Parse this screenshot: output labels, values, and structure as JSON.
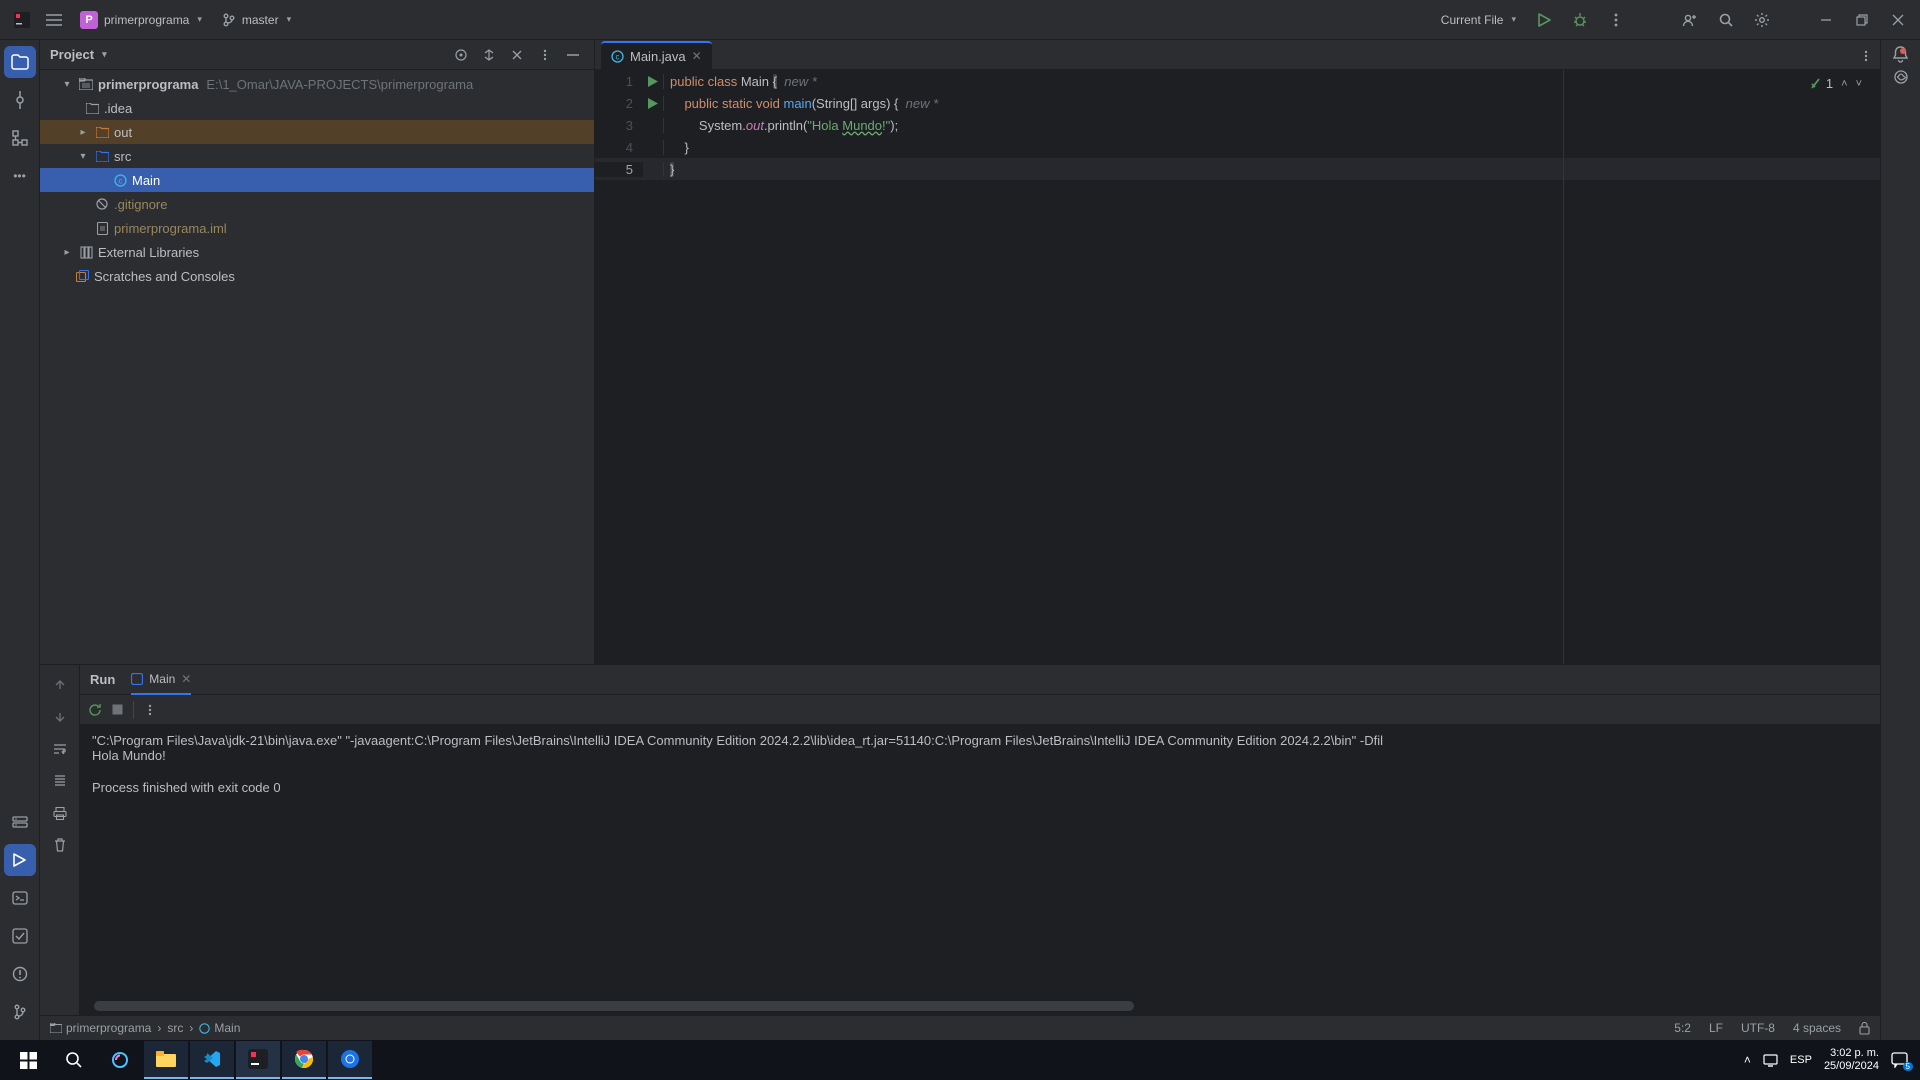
{
  "titlebar": {
    "project_letter": "P",
    "project_name": "primerprograma",
    "branch": "master",
    "run_config": "Current File"
  },
  "left_strip": [
    "project",
    "commit",
    "structure",
    "more"
  ],
  "project_tool": {
    "title": "Project",
    "root": {
      "name": "primerprograma",
      "path": "E:\\1_Omar\\JAVA-PROJECTS\\primerprograma"
    },
    "idea": ".idea",
    "out": "out",
    "src": "src",
    "main": "Main",
    "gitignore": ".gitignore",
    "iml": "primerprograma.iml",
    "ext_lib": "External Libraries",
    "scratches": "Scratches and Consoles"
  },
  "editor": {
    "tab": "Main.java",
    "problems_count": "1",
    "lines": {
      "l1_new": "new *",
      "l2_new": "new *",
      "l3_str": "\"Hola Mundo!\""
    }
  },
  "run": {
    "title": "Run",
    "config_tab": "Main",
    "console": {
      "line1": "\"C:\\Program Files\\Java\\jdk-21\\bin\\java.exe\" \"-javaagent:C:\\Program Files\\JetBrains\\IntelliJ IDEA Community Edition 2024.2.2\\lib\\idea_rt.jar=51140:C:\\Program Files\\JetBrains\\IntelliJ IDEA Community Edition 2024.2.2\\bin\" -Dfil",
      "line2": "Hola Mundo!",
      "line3": "",
      "line4": "Process finished with exit code 0"
    }
  },
  "breadcrumbs": {
    "p1": "primerprograma",
    "p2": "src",
    "p3": "Main"
  },
  "status_right": {
    "pos": "5:2",
    "sep": "LF",
    "enc": "UTF-8",
    "indent": "4 spaces"
  },
  "taskbar": {
    "lang": "ESP",
    "time": "3:02 p. m.",
    "date": "25/09/2024"
  }
}
